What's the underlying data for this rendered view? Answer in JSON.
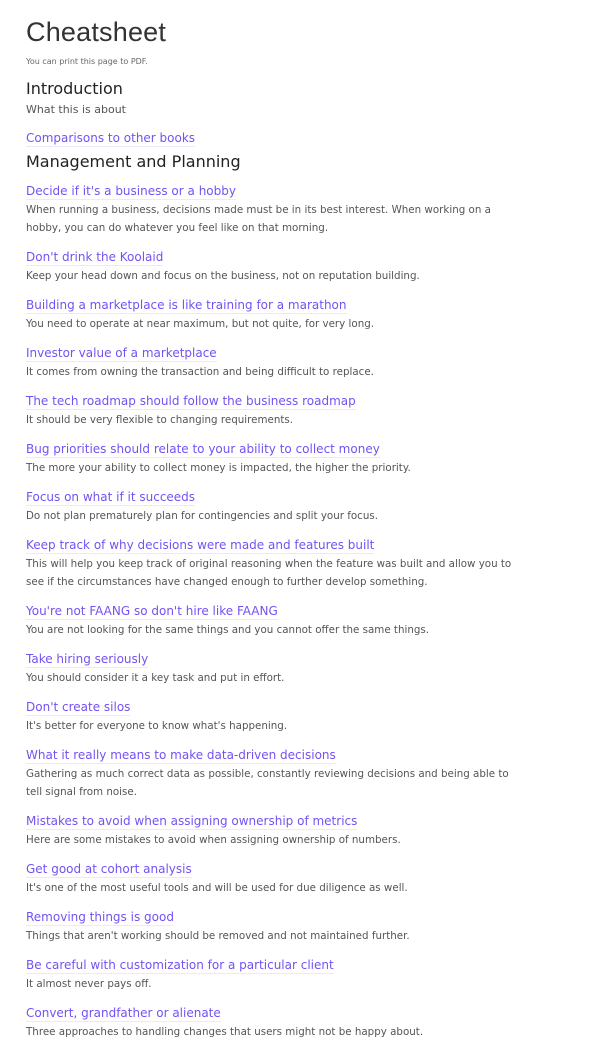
{
  "page": {
    "title": "Cheatsheet",
    "print_note": "You can print this page to PDF."
  },
  "sections": {
    "introduction": {
      "heading": "Introduction",
      "subtitle": "What this is about",
      "entries": [
        {
          "title": "Comparisons to other books",
          "description": ""
        }
      ]
    },
    "management": {
      "heading": "Management and Planning",
      "entries": [
        {
          "title": "Decide if it's a business or a hobby",
          "description": "When running a business, decisions made must be in its best interest. When working on a hobby, you can do whatever you feel like on that morning."
        },
        {
          "title": "Don't drink the Koolaid",
          "description": "Keep your head down and focus on the business, not on reputation building."
        },
        {
          "title": "Building a marketplace is like training for a marathon",
          "description": "You need to operate at near maximum, but not quite, for very long."
        },
        {
          "title": "Investor value of a marketplace",
          "description": "It comes from owning the transaction and being difficult to replace."
        },
        {
          "title": "The tech roadmap should follow the business roadmap",
          "description": "It should be very flexible to changing requirements."
        },
        {
          "title": "Bug priorities should relate to your ability to collect money",
          "description": "The more your ability to collect money is impacted, the higher the priority."
        },
        {
          "title": "Focus on what if it succeeds",
          "description": "Do not plan prematurely plan for contingencies and split your focus."
        },
        {
          "title": "Keep track of why decisions were made and features built",
          "description": "This will help you keep track of original reasoning when the feature was built and allow you to see if the circumstances have changed enough to further develop something."
        },
        {
          "title": "You're not FAANG so don't hire like FAANG",
          "description": "You are not looking for the same things and you cannot offer the same things."
        },
        {
          "title": "Take hiring seriously",
          "description": "You should consider it a key task and put in effort."
        },
        {
          "title": "Don't create silos",
          "description": "It's better for everyone to know what's happening."
        },
        {
          "title": "What it really means to make data-driven decisions",
          "description": "Gathering as much correct data as possible, constantly reviewing decisions and being able to tell signal from noise."
        },
        {
          "title": "Mistakes to avoid when assigning ownership of metrics",
          "description": "Here are some mistakes to avoid when assigning ownership of numbers."
        },
        {
          "title": "Get good at cohort analysis",
          "description": "It's one of the most useful tools and will be used for due diligence as well."
        },
        {
          "title": "Removing things is good",
          "description": "Things that aren't working should be removed and not maintained further."
        },
        {
          "title": "Be careful with customization for a particular client",
          "description": "It almost never pays off."
        },
        {
          "title": "Convert, grandfather or alienate",
          "description": "Three approaches to handling changes that users might not be happy about."
        }
      ]
    }
  },
  "colors": {
    "link": "#7452f2",
    "heading": "#222222",
    "body_text": "#555555"
  }
}
